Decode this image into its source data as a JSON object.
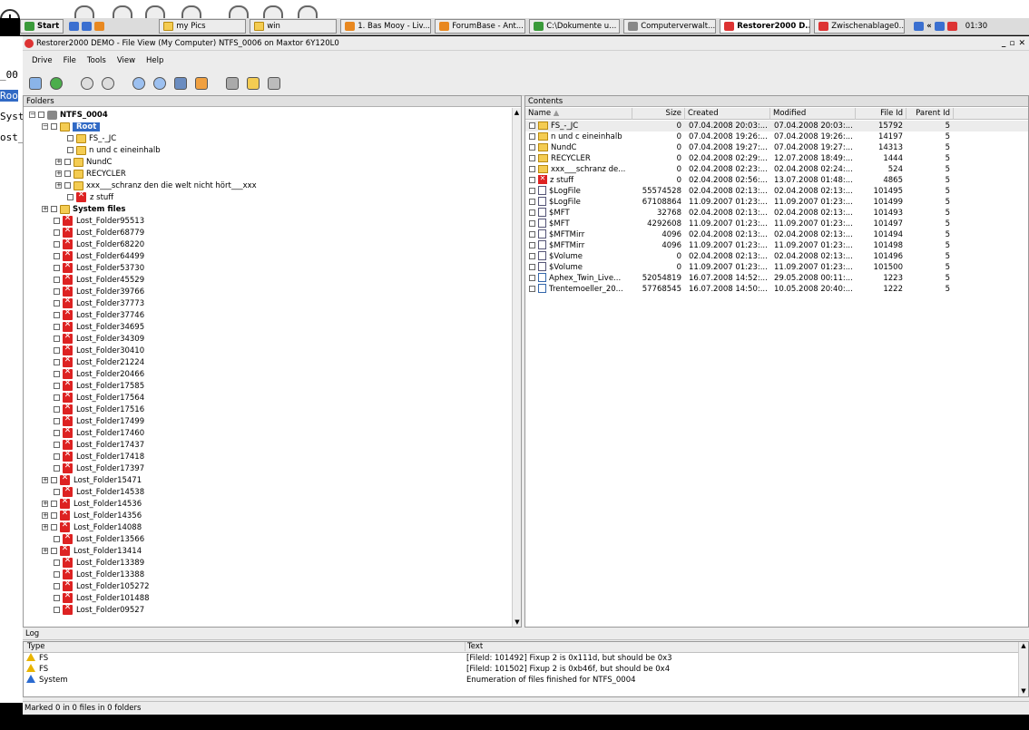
{
  "taskbar": {
    "start": "Start",
    "tasks": [
      {
        "label": "my Pics",
        "icon": "folder-icon"
      },
      {
        "label": "win",
        "icon": "folder-icon"
      },
      {
        "label": "1. Bas Mooy - Liv...",
        "icon": "music-icon"
      },
      {
        "label": "ForumBase - Ant...",
        "icon": "browser-icon"
      },
      {
        "label": "C:\\Dokumente u...",
        "icon": "explorer-icon"
      },
      {
        "label": "Computerverwalt...",
        "icon": "computer-icon"
      },
      {
        "label": "Restorer2000 D...",
        "icon": "restorer-icon",
        "active": true
      },
      {
        "label": "Zwischenablage0...",
        "icon": "clipboard-icon"
      }
    ],
    "tray_arrow": "«",
    "clock": "01:30"
  },
  "left_strip": {
    "line1": "_00",
    "line2": "Roo",
    "line3": "Syst",
    "line4": "ost_"
  },
  "window": {
    "title": "Restorer2000 DEMO - File View (My Computer) NTFS_0006 on Maxtor 6Y120L0",
    "controls": [
      "_",
      "▫",
      "✕"
    ]
  },
  "menu": [
    "Drive",
    "File",
    "Tools",
    "View",
    "Help"
  ],
  "toolbar": [
    "connect-icon",
    "refresh-icon",
    "back-icon",
    "forward-icon",
    "find-icon",
    "find-next-icon",
    "binoculars-icon",
    "copy-icon",
    "disk-icon",
    "open-folder-icon",
    "properties-icon"
  ],
  "folders": {
    "header": "Folders",
    "drive": "NTFS_0004",
    "root": "Root",
    "root_children": [
      "FS_-_JC",
      "n und c eineinhalb",
      "NundC",
      "RECYCLER",
      "xxx___schranz den die welt nicht hört___xxx",
      "z stuff"
    ],
    "system_files": "System files",
    "lost": [
      "Lost_Folder95513",
      "Lost_Folder68779",
      "Lost_Folder68220",
      "Lost_Folder64499",
      "Lost_Folder53730",
      "Lost_Folder45529",
      "Lost_Folder39766",
      "Lost_Folder37773",
      "Lost_Folder37746",
      "Lost_Folder34695",
      "Lost_Folder34309",
      "Lost_Folder30410",
      "Lost_Folder21224",
      "Lost_Folder20466",
      "Lost_Folder17585",
      "Lost_Folder17564",
      "Lost_Folder17516",
      "Lost_Folder17499",
      "Lost_Folder17460",
      "Lost_Folder17437",
      "Lost_Folder17418",
      "Lost_Folder17397",
      "Lost_Folder15471",
      "Lost_Folder14538",
      "Lost_Folder14536",
      "Lost_Folder14356",
      "Lost_Folder14088",
      "Lost_Folder13566",
      "Lost_Folder13414",
      "Lost_Folder13389",
      "Lost_Folder13388",
      "Lost_Folder105272",
      "Lost_Folder101488",
      "Lost_Folder09527"
    ]
  },
  "contents": {
    "header": "Contents",
    "columns": [
      "Name",
      "Size",
      "Created",
      "Modified",
      "File Id",
      "Parent Id"
    ],
    "rows": [
      {
        "name": "FS_-_JC",
        "size": "0",
        "created": "07.04.2008 20:03:...",
        "modified": "07.04.2008 20:03:...",
        "id": "15792",
        "parent": "5",
        "kind": "folder"
      },
      {
        "name": "n und c eineinhalb",
        "size": "0",
        "created": "07.04.2008 19:26:...",
        "modified": "07.04.2008 19:26:...",
        "id": "14197",
        "parent": "5",
        "kind": "folder"
      },
      {
        "name": "NundC",
        "size": "0",
        "created": "07.04.2008 19:27:...",
        "modified": "07.04.2008 19:27:...",
        "id": "14313",
        "parent": "5",
        "kind": "folder"
      },
      {
        "name": "RECYCLER",
        "size": "0",
        "created": "02.04.2008 02:29:...",
        "modified": "12.07.2008 18:49:...",
        "id": "1444",
        "parent": "5",
        "kind": "folder"
      },
      {
        "name": "xxx___schranz de...",
        "size": "0",
        "created": "02.04.2008 02:23:...",
        "modified": "02.04.2008 02:24:...",
        "id": "524",
        "parent": "5",
        "kind": "folder"
      },
      {
        "name": "z stuff",
        "size": "0",
        "created": "02.04.2008 02:56:...",
        "modified": "13.07.2008 01:48:...",
        "id": "4865",
        "parent": "5",
        "kind": "deleted"
      },
      {
        "name": "$LogFile",
        "size": "55574528",
        "created": "02.04.2008 02:13:...",
        "modified": "02.04.2008 02:13:...",
        "id": "101495",
        "parent": "5",
        "kind": "file"
      },
      {
        "name": "$LogFile",
        "size": "67108864",
        "created": "11.09.2007 01:23:...",
        "modified": "11.09.2007 01:23:...",
        "id": "101499",
        "parent": "5",
        "kind": "file"
      },
      {
        "name": "$MFT",
        "size": "32768",
        "created": "02.04.2008 02:13:...",
        "modified": "02.04.2008 02:13:...",
        "id": "101493",
        "parent": "5",
        "kind": "file"
      },
      {
        "name": "$MFT",
        "size": "4292608",
        "created": "11.09.2007 01:23:...",
        "modified": "11.09.2007 01:23:...",
        "id": "101497",
        "parent": "5",
        "kind": "file"
      },
      {
        "name": "$MFTMirr",
        "size": "4096",
        "created": "02.04.2008 02:13:...",
        "modified": "02.04.2008 02:13:...",
        "id": "101494",
        "parent": "5",
        "kind": "file"
      },
      {
        "name": "$MFTMirr",
        "size": "4096",
        "created": "11.09.2007 01:23:...",
        "modified": "11.09.2007 01:23:...",
        "id": "101498",
        "parent": "5",
        "kind": "file"
      },
      {
        "name": "$Volume",
        "size": "0",
        "created": "02.04.2008 02:13:...",
        "modified": "02.04.2008 02:13:...",
        "id": "101496",
        "parent": "5",
        "kind": "file"
      },
      {
        "name": "$Volume",
        "size": "0",
        "created": "11.09.2007 01:23:...",
        "modified": "11.09.2007 01:23:...",
        "id": "101500",
        "parent": "5",
        "kind": "file"
      },
      {
        "name": "Aphex_Twin_Live...",
        "size": "52054819",
        "created": "16.07.2008 14:52:...",
        "modified": "29.05.2008 00:11:...",
        "id": "1223",
        "parent": "5",
        "kind": "media"
      },
      {
        "name": "Trentemoeller_20...",
        "size": "57768545",
        "created": "16.07.2008 14:50:...",
        "modified": "10.05.2008 20:40:...",
        "id": "1222",
        "parent": "5",
        "kind": "media"
      }
    ]
  },
  "log": {
    "header": "Log",
    "columns": [
      "Type",
      "Text"
    ],
    "rows": [
      {
        "type": "FS",
        "text": "[FileId: 101492] Fixup 2 is 0x111d, but should be 0x3",
        "level": "warn"
      },
      {
        "type": "FS",
        "text": "[FileId: 101502] Fixup 2 is 0xb46f, but should be 0x4",
        "level": "warn"
      },
      {
        "type": "System",
        "text": "Enumeration of files finished for NTFS_0004",
        "level": "info"
      }
    ]
  },
  "status": "Marked 0 in 0 files in 0 folders"
}
